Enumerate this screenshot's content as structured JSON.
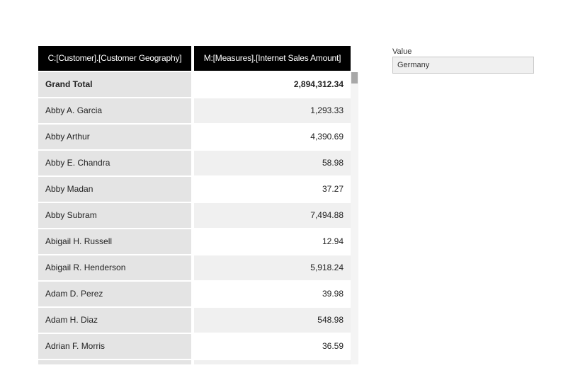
{
  "table": {
    "columns": [
      "C:[Customer].[Customer Geography]",
      "M:[Measures].[Internet Sales Amount]"
    ],
    "grand_total": {
      "label": "Grand Total",
      "value": "2,894,312.34"
    },
    "rows": [
      {
        "name": "Abby A. Garcia",
        "value": "1,293.33"
      },
      {
        "name": "Abby Arthur",
        "value": "4,390.69"
      },
      {
        "name": "Abby E. Chandra",
        "value": "58.98"
      },
      {
        "name": "Abby Madan",
        "value": "37.27"
      },
      {
        "name": "Abby Subram",
        "value": "7,494.88"
      },
      {
        "name": "Abigail H. Russell",
        "value": "12.94"
      },
      {
        "name": "Abigail R. Henderson",
        "value": "5,918.24"
      },
      {
        "name": "Adam D. Perez",
        "value": "39.98"
      },
      {
        "name": "Adam H. Diaz",
        "value": "548.98"
      },
      {
        "name": "Adrian F. Morris",
        "value": "36.59"
      }
    ]
  },
  "filter": {
    "label": "Value",
    "value": "Germany"
  }
}
